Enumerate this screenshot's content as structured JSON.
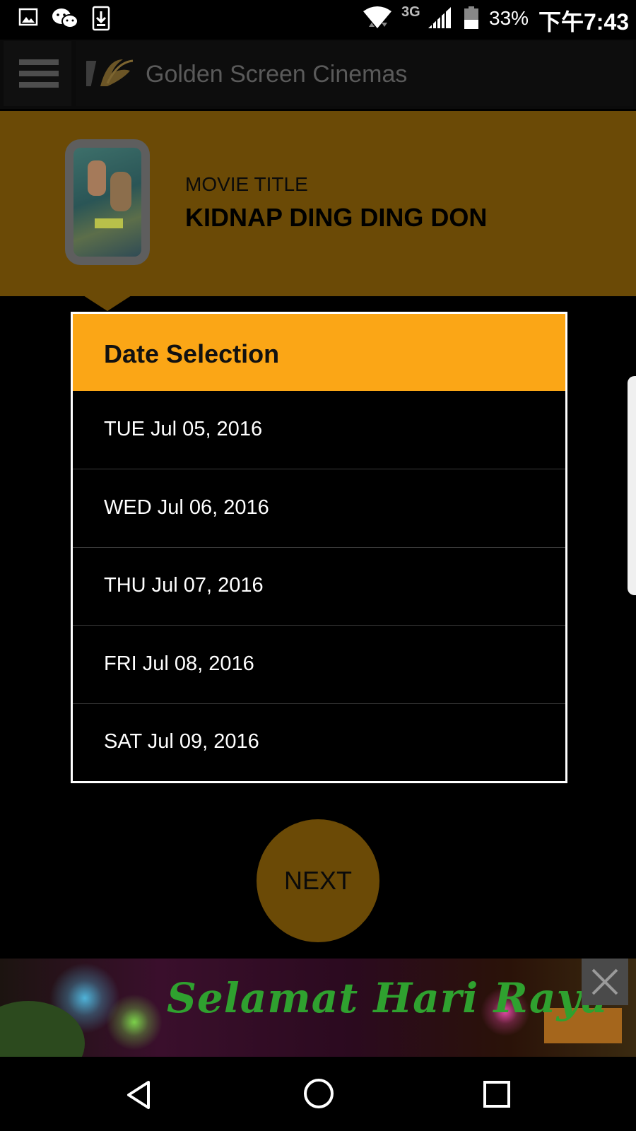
{
  "status_bar": {
    "network": "3G",
    "battery": "33%",
    "time": "下午7:43",
    "icons": [
      "image-icon",
      "wechat-icon",
      "download-icon",
      "wifi-icon",
      "signal-icon",
      "battery-icon"
    ]
  },
  "app_bar": {
    "title": "Golden Screen Cinemas",
    "icons": [
      "menu-icon",
      "gsc-logo"
    ]
  },
  "movie": {
    "label": "MOVIE TITLE",
    "title": "KIDNAP DING DING DON"
  },
  "dialog": {
    "title": "Date Selection",
    "dates": [
      "TUE Jul 05, 2016",
      "WED Jul 06, 2016",
      "THU Jul 07, 2016",
      "FRI Jul 08, 2016",
      "SAT Jul 09, 2016"
    ]
  },
  "next_button": {
    "label": "NEXT"
  },
  "banner": {
    "text": "Selamat Hari Raya",
    "close_icon": "close-icon"
  },
  "colors": {
    "accent": "#fba616",
    "dimmed_accent": "#6b4a06",
    "banner_text": "#2fa12f"
  },
  "nav_bar": {
    "icons": [
      "back-icon",
      "home-icon",
      "recents-icon"
    ]
  }
}
